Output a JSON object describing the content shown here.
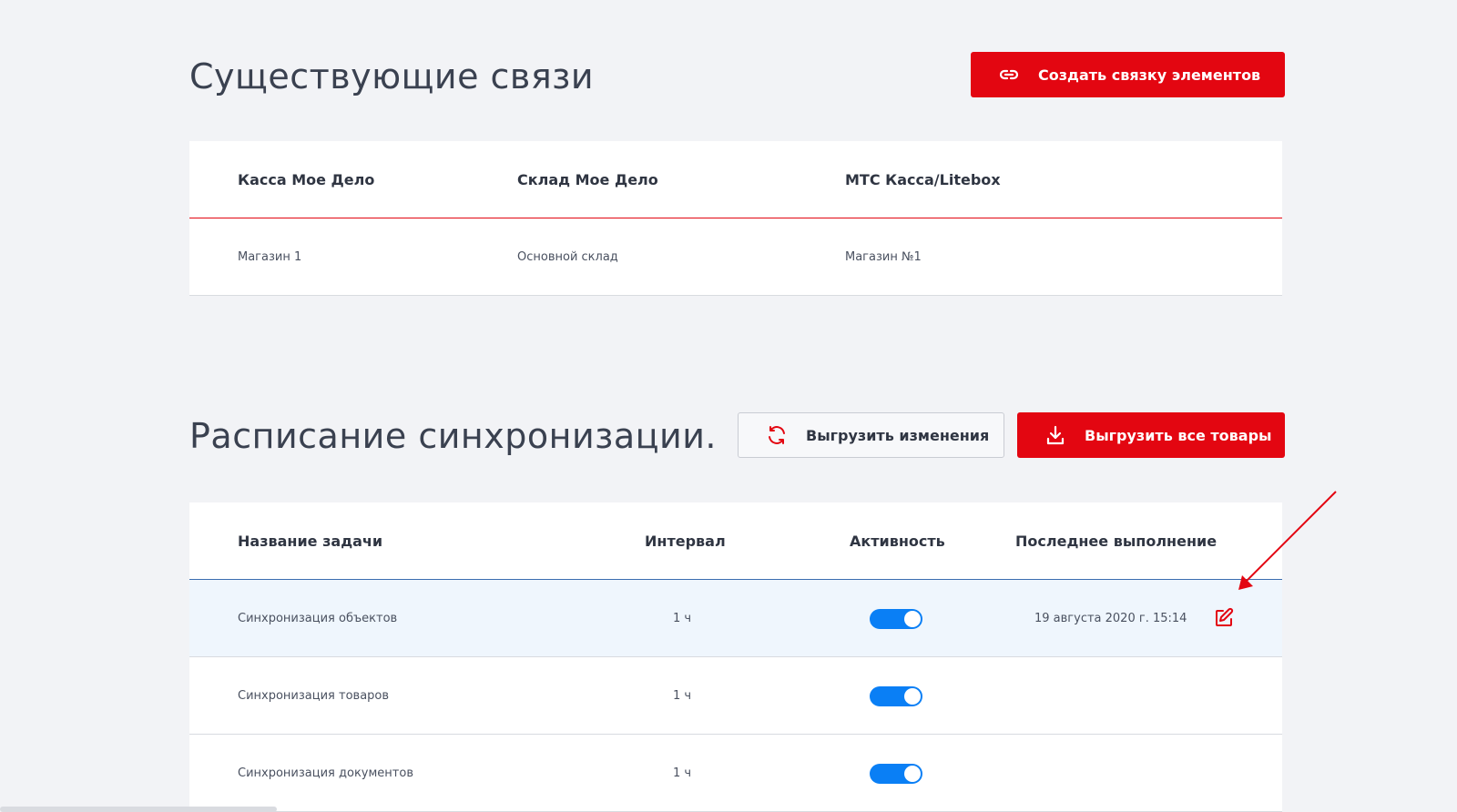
{
  "connections": {
    "title": "Существующие связи",
    "create_button": "Создать связку элементов",
    "columns": [
      "Касса Мое Дело",
      "Склад Мое Дело",
      "МТС Касса/Litebox"
    ],
    "rows": [
      [
        "Магазин 1",
        "Основной склад",
        "Магазин №1"
      ]
    ]
  },
  "schedule": {
    "title": "Расписание синхронизации.",
    "upload_changes_button": "Выгрузить изменения",
    "upload_all_button": "Выгрузить все товары",
    "columns": {
      "name": "Название задачи",
      "interval": "Интервал",
      "activity": "Активность",
      "last_run": "Последнее выполнение"
    },
    "rows": [
      {
        "name": "Синхронизация объектов",
        "interval": "1 ч",
        "active": true,
        "last_run": "19 августа 2020 г. 15:14"
      },
      {
        "name": "Синхронизация товаров",
        "interval": "1 ч",
        "active": true,
        "last_run": ""
      },
      {
        "name": "Синхронизация документов",
        "interval": "1 ч",
        "active": true,
        "last_run": ""
      }
    ]
  },
  "colors": {
    "accent_red": "#e30611",
    "toggle_blue": "#0a7ff5"
  },
  "icons": {
    "create_button": "link-icon",
    "upload_changes": "sync-icon",
    "upload_all": "download-icon",
    "row_action": "edit-icon"
  }
}
